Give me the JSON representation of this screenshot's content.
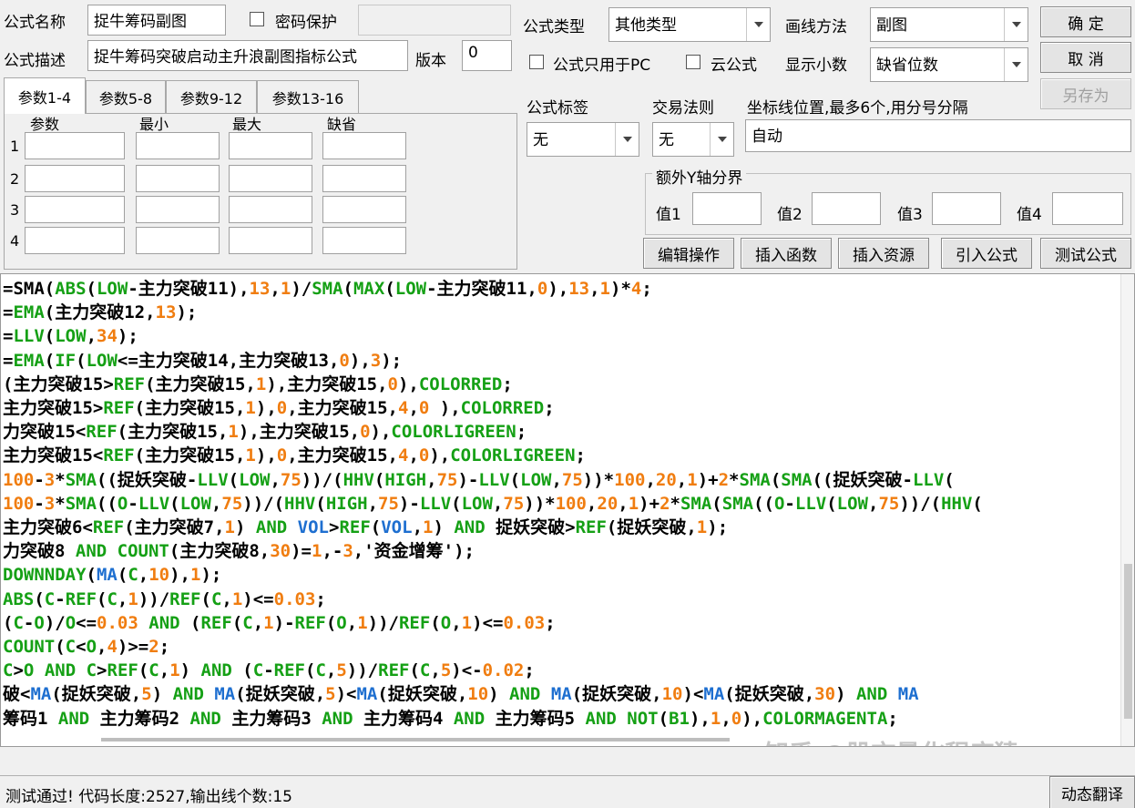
{
  "form": {
    "name_label": "公式名称",
    "name_value": "捉牛筹码副图",
    "password_label": "密码保护",
    "password_value": "",
    "desc_label": "公式描述",
    "desc_value": "捉牛筹码突破启动主升浪副图指标公式",
    "version_label": "版本",
    "version_value": "0",
    "type_label": "公式类型",
    "type_value": "其他类型",
    "draw_label": "画线方法",
    "draw_value": "副图",
    "pc_only_label": "公式只用于PC",
    "cloud_label": "云公式",
    "decimal_label": "显示小数",
    "decimal_value": "缺省位数",
    "tag_label": "公式标签",
    "tag_value": "无",
    "rule_label": "交易法则",
    "rule_value": "无",
    "axis_label": "坐标线位置,最多6个,用分号分隔",
    "axis_value": "自动",
    "extra_y_label": "额外Y轴分界",
    "val_labels": [
      "值1",
      "值2",
      "值3",
      "值4"
    ]
  },
  "buttons": {
    "ok": "确  定",
    "cancel": "取  消",
    "save_as": "另存为",
    "edit_ops": "编辑操作",
    "insert_func": "插入函数",
    "insert_res": "插入资源",
    "import": "引入公式",
    "test": "测试公式",
    "dyn_translate": "动态翻译"
  },
  "params": {
    "tabs": [
      "参数1-4",
      "参数5-8",
      "参数9-12",
      "参数13-16"
    ],
    "headers": [
      "参数",
      "最小",
      "最大",
      "缺省"
    ],
    "rows": [
      "1",
      "2",
      "3",
      "4"
    ]
  },
  "code_lines": [
    [
      [
        "k",
        "=SMA("
      ],
      [
        "g",
        "ABS"
      ],
      [
        "k",
        "("
      ],
      [
        "g",
        "LOW"
      ],
      [
        "k",
        "-主力突破11),"
      ],
      [
        "o",
        "13"
      ],
      [
        "k",
        ","
      ],
      [
        "o",
        "1"
      ],
      [
        "k",
        ")/"
      ],
      [
        "g",
        "SMA"
      ],
      [
        "k",
        "("
      ],
      [
        "g",
        "MAX"
      ],
      [
        "k",
        "("
      ],
      [
        "g",
        "LOW"
      ],
      [
        "k",
        "-主力突破11,"
      ],
      [
        "o",
        "0"
      ],
      [
        "k",
        "),"
      ],
      [
        "o",
        "13"
      ],
      [
        "k",
        ","
      ],
      [
        "o",
        "1"
      ],
      [
        "k",
        ")*"
      ],
      [
        "o",
        "4"
      ],
      [
        "k",
        ";"
      ]
    ],
    [
      [
        "k",
        "="
      ],
      [
        "g",
        "EMA"
      ],
      [
        "k",
        "(主力突破12,"
      ],
      [
        "o",
        "13"
      ],
      [
        "k",
        ");"
      ]
    ],
    [
      [
        "k",
        "="
      ],
      [
        "g",
        "LLV"
      ],
      [
        "k",
        "("
      ],
      [
        "g",
        "LOW"
      ],
      [
        "k",
        ","
      ],
      [
        "o",
        "34"
      ],
      [
        "k",
        ");"
      ]
    ],
    [
      [
        "k",
        "="
      ],
      [
        "g",
        "EMA"
      ],
      [
        "k",
        "("
      ],
      [
        "g",
        "IF"
      ],
      [
        "k",
        "("
      ],
      [
        "g",
        "LOW"
      ],
      [
        "k",
        "<=主力突破14,主力突破13,"
      ],
      [
        "o",
        "0"
      ],
      [
        "k",
        "),"
      ],
      [
        "o",
        "3"
      ],
      [
        "k",
        ");"
      ]
    ],
    [
      [
        "k",
        "(主力突破15>"
      ],
      [
        "g",
        "REF"
      ],
      [
        "k",
        "(主力突破15,"
      ],
      [
        "o",
        "1"
      ],
      [
        "k",
        "),主力突破15,"
      ],
      [
        "o",
        "0"
      ],
      [
        "k",
        "),"
      ],
      [
        "g",
        "COLORRED"
      ],
      [
        "k",
        ";"
      ]
    ],
    [
      [
        "k",
        "主力突破15>"
      ],
      [
        "g",
        "REF"
      ],
      [
        "k",
        "(主力突破15,"
      ],
      [
        "o",
        "1"
      ],
      [
        "k",
        "),"
      ],
      [
        "o",
        "0"
      ],
      [
        "k",
        ",主力突破15,"
      ],
      [
        "o",
        "4"
      ],
      [
        "k",
        ","
      ],
      [
        "o",
        "0"
      ],
      [
        "k",
        " ),"
      ],
      [
        "g",
        "COLORRED"
      ],
      [
        "k",
        ";"
      ]
    ],
    [
      [
        "k",
        "力突破15<"
      ],
      [
        "g",
        "REF"
      ],
      [
        "k",
        "(主力突破15,"
      ],
      [
        "o",
        "1"
      ],
      [
        "k",
        "),主力突破15,"
      ],
      [
        "o",
        "0"
      ],
      [
        "k",
        "),"
      ],
      [
        "g",
        "COLORLIGREEN"
      ],
      [
        "k",
        ";"
      ]
    ],
    [
      [
        "k",
        "主力突破15<"
      ],
      [
        "g",
        "REF"
      ],
      [
        "k",
        "(主力突破15,"
      ],
      [
        "o",
        "1"
      ],
      [
        "k",
        "),"
      ],
      [
        "o",
        "0"
      ],
      [
        "k",
        ",主力突破15,"
      ],
      [
        "o",
        "4"
      ],
      [
        "k",
        ","
      ],
      [
        "o",
        "0"
      ],
      [
        "k",
        "),"
      ],
      [
        "g",
        "COLORLIGREEN"
      ],
      [
        "k",
        ";"
      ]
    ],
    [
      [
        "o",
        "100"
      ],
      [
        "k",
        "-"
      ],
      [
        "o",
        "3"
      ],
      [
        "k",
        "*"
      ],
      [
        "g",
        "SMA"
      ],
      [
        "k",
        "((捉妖突破-"
      ],
      [
        "g",
        "LLV"
      ],
      [
        "k",
        "("
      ],
      [
        "g",
        "LOW"
      ],
      [
        "k",
        ","
      ],
      [
        "o",
        "75"
      ],
      [
        "k",
        "))/("
      ],
      [
        "g",
        "HHV"
      ],
      [
        "k",
        "("
      ],
      [
        "g",
        "HIGH"
      ],
      [
        "k",
        ","
      ],
      [
        "o",
        "75"
      ],
      [
        "k",
        ")-"
      ],
      [
        "g",
        "LLV"
      ],
      [
        "k",
        "("
      ],
      [
        "g",
        "LOW"
      ],
      [
        "k",
        ","
      ],
      [
        "o",
        "75"
      ],
      [
        "k",
        "))*"
      ],
      [
        "o",
        "100"
      ],
      [
        "k",
        ","
      ],
      [
        "o",
        "20"
      ],
      [
        "k",
        ","
      ],
      [
        "o",
        "1"
      ],
      [
        "k",
        ")+"
      ],
      [
        "o",
        "2"
      ],
      [
        "k",
        "*"
      ],
      [
        "g",
        "SMA"
      ],
      [
        "k",
        "("
      ],
      [
        "g",
        "SMA"
      ],
      [
        "k",
        "((捉妖突破-"
      ],
      [
        "g",
        "LLV"
      ],
      [
        "k",
        "("
      ]
    ],
    [
      [
        "o",
        "100"
      ],
      [
        "k",
        "-"
      ],
      [
        "o",
        "3"
      ],
      [
        "k",
        "*"
      ],
      [
        "g",
        "SMA"
      ],
      [
        "k",
        "(("
      ],
      [
        "g",
        "O"
      ],
      [
        "k",
        "-"
      ],
      [
        "g",
        "LLV"
      ],
      [
        "k",
        "("
      ],
      [
        "g",
        "LOW"
      ],
      [
        "k",
        ","
      ],
      [
        "o",
        "75"
      ],
      [
        "k",
        "))/("
      ],
      [
        "g",
        "HHV"
      ],
      [
        "k",
        "("
      ],
      [
        "g",
        "HIGH"
      ],
      [
        "k",
        ","
      ],
      [
        "o",
        "75"
      ],
      [
        "k",
        ")-"
      ],
      [
        "g",
        "LLV"
      ],
      [
        "k",
        "("
      ],
      [
        "g",
        "LOW"
      ],
      [
        "k",
        ","
      ],
      [
        "o",
        "75"
      ],
      [
        "k",
        "))*"
      ],
      [
        "o",
        "100"
      ],
      [
        "k",
        ","
      ],
      [
        "o",
        "20"
      ],
      [
        "k",
        ","
      ],
      [
        "o",
        "1"
      ],
      [
        "k",
        ")+"
      ],
      [
        "o",
        "2"
      ],
      [
        "k",
        "*"
      ],
      [
        "g",
        "SMA"
      ],
      [
        "k",
        "("
      ],
      [
        "g",
        "SMA"
      ],
      [
        "k",
        "(("
      ],
      [
        "g",
        "O"
      ],
      [
        "k",
        "-"
      ],
      [
        "g",
        "LLV"
      ],
      [
        "k",
        "("
      ],
      [
        "g",
        "LOW"
      ],
      [
        "k",
        ","
      ],
      [
        "o",
        "75"
      ],
      [
        "k",
        "))/("
      ],
      [
        "g",
        "HHV"
      ],
      [
        "k",
        "("
      ]
    ],
    [
      [
        "k",
        "主力突破6<"
      ],
      [
        "g",
        "REF"
      ],
      [
        "k",
        "(主力突破7,"
      ],
      [
        "o",
        "1"
      ],
      [
        "k",
        ") "
      ],
      [
        "g",
        "AND"
      ],
      [
        "k",
        " "
      ],
      [
        "b",
        "VOL"
      ],
      [
        "k",
        ">"
      ],
      [
        "g",
        "REF"
      ],
      [
        "k",
        "("
      ],
      [
        "b",
        "VOL"
      ],
      [
        "k",
        ","
      ],
      [
        "o",
        "1"
      ],
      [
        "k",
        ") "
      ],
      [
        "g",
        "AND"
      ],
      [
        "k",
        " 捉妖突破>"
      ],
      [
        "g",
        "REF"
      ],
      [
        "k",
        "(捉妖突破,"
      ],
      [
        "o",
        "1"
      ],
      [
        "k",
        ");"
      ]
    ],
    [
      [
        "k",
        "力突破8 "
      ],
      [
        "g",
        "AND"
      ],
      [
        "k",
        " "
      ],
      [
        "g",
        "COUNT"
      ],
      [
        "k",
        "(主力突破8,"
      ],
      [
        "o",
        "30"
      ],
      [
        "k",
        ")="
      ],
      [
        "o",
        "1"
      ],
      [
        "k",
        ",-"
      ],
      [
        "o",
        "3"
      ],
      [
        "k",
        ",'资金增筹');"
      ]
    ],
    [
      [
        "g",
        "DOWNNDAY"
      ],
      [
        "k",
        "("
      ],
      [
        "b",
        "MA"
      ],
      [
        "k",
        "("
      ],
      [
        "g",
        "C"
      ],
      [
        "k",
        ","
      ],
      [
        "o",
        "10"
      ],
      [
        "k",
        "),"
      ],
      [
        "o",
        "1"
      ],
      [
        "k",
        ");"
      ]
    ],
    [
      [
        "g",
        "ABS"
      ],
      [
        "k",
        "("
      ],
      [
        "g",
        "C"
      ],
      [
        "k",
        "-"
      ],
      [
        "g",
        "REF"
      ],
      [
        "k",
        "("
      ],
      [
        "g",
        "C"
      ],
      [
        "k",
        ","
      ],
      [
        "o",
        "1"
      ],
      [
        "k",
        "))/"
      ],
      [
        "g",
        "REF"
      ],
      [
        "k",
        "("
      ],
      [
        "g",
        "C"
      ],
      [
        "k",
        ","
      ],
      [
        "o",
        "1"
      ],
      [
        "k",
        ")<="
      ],
      [
        "o",
        "0.03"
      ],
      [
        "k",
        ";"
      ]
    ],
    [
      [
        "k",
        "("
      ],
      [
        "g",
        "C"
      ],
      [
        "k",
        "-"
      ],
      [
        "g",
        "O"
      ],
      [
        "k",
        ")/"
      ],
      [
        "g",
        "O"
      ],
      [
        "k",
        "<="
      ],
      [
        "o",
        "0.03"
      ],
      [
        "k",
        " "
      ],
      [
        "g",
        "AND"
      ],
      [
        "k",
        " ("
      ],
      [
        "g",
        "REF"
      ],
      [
        "k",
        "("
      ],
      [
        "g",
        "C"
      ],
      [
        "k",
        ","
      ],
      [
        "o",
        "1"
      ],
      [
        "k",
        ")-"
      ],
      [
        "g",
        "REF"
      ],
      [
        "k",
        "("
      ],
      [
        "g",
        "O"
      ],
      [
        "k",
        ","
      ],
      [
        "o",
        "1"
      ],
      [
        "k",
        "))/"
      ],
      [
        "g",
        "REF"
      ],
      [
        "k",
        "("
      ],
      [
        "g",
        "O"
      ],
      [
        "k",
        ","
      ],
      [
        "o",
        "1"
      ],
      [
        "k",
        ")<="
      ],
      [
        "o",
        "0.03"
      ],
      [
        "k",
        ";"
      ]
    ],
    [
      [
        "g",
        "COUNT"
      ],
      [
        "k",
        "("
      ],
      [
        "g",
        "C"
      ],
      [
        "k",
        "<"
      ],
      [
        "g",
        "O"
      ],
      [
        "k",
        ","
      ],
      [
        "o",
        "4"
      ],
      [
        "k",
        ")>="
      ],
      [
        "o",
        "2"
      ],
      [
        "k",
        ";"
      ]
    ],
    [
      [
        "g",
        "C"
      ],
      [
        "k",
        ">"
      ],
      [
        "g",
        "O"
      ],
      [
        "k",
        " "
      ],
      [
        "g",
        "AND"
      ],
      [
        "k",
        " "
      ],
      [
        "g",
        "C"
      ],
      [
        "k",
        ">"
      ],
      [
        "g",
        "REF"
      ],
      [
        "k",
        "("
      ],
      [
        "g",
        "C"
      ],
      [
        "k",
        ","
      ],
      [
        "o",
        "1"
      ],
      [
        "k",
        ") "
      ],
      [
        "g",
        "AND"
      ],
      [
        "k",
        " ("
      ],
      [
        "g",
        "C"
      ],
      [
        "k",
        "-"
      ],
      [
        "g",
        "REF"
      ],
      [
        "k",
        "("
      ],
      [
        "g",
        "C"
      ],
      [
        "k",
        ","
      ],
      [
        "o",
        "5"
      ],
      [
        "k",
        "))/"
      ],
      [
        "g",
        "REF"
      ],
      [
        "k",
        "("
      ],
      [
        "g",
        "C"
      ],
      [
        "k",
        ","
      ],
      [
        "o",
        "5"
      ],
      [
        "k",
        ")<-"
      ],
      [
        "o",
        "0.02"
      ],
      [
        "k",
        ";"
      ]
    ],
    [
      [
        "k",
        "破<"
      ],
      [
        "b",
        "MA"
      ],
      [
        "k",
        "(捉妖突破,"
      ],
      [
        "o",
        "5"
      ],
      [
        "k",
        ") "
      ],
      [
        "g",
        "AND"
      ],
      [
        "k",
        " "
      ],
      [
        "b",
        "MA"
      ],
      [
        "k",
        "(捉妖突破,"
      ],
      [
        "o",
        "5"
      ],
      [
        "k",
        ")<"
      ],
      [
        "b",
        "MA"
      ],
      [
        "k",
        "(捉妖突破,"
      ],
      [
        "o",
        "10"
      ],
      [
        "k",
        ") "
      ],
      [
        "g",
        "AND"
      ],
      [
        "k",
        " "
      ],
      [
        "b",
        "MA"
      ],
      [
        "k",
        "(捉妖突破,"
      ],
      [
        "o",
        "10"
      ],
      [
        "k",
        ")<"
      ],
      [
        "b",
        "MA"
      ],
      [
        "k",
        "(捉妖突破,"
      ],
      [
        "o",
        "30"
      ],
      [
        "k",
        ") "
      ],
      [
        "g",
        "AND"
      ],
      [
        "k",
        " "
      ],
      [
        "b",
        "MA"
      ]
    ],
    [
      [
        "k",
        "筹码1 "
      ],
      [
        "g",
        "AND"
      ],
      [
        "k",
        " 主力筹码2 "
      ],
      [
        "g",
        "AND"
      ],
      [
        "k",
        " 主力筹码3 "
      ],
      [
        "g",
        "AND"
      ],
      [
        "k",
        " 主力筹码4 "
      ],
      [
        "g",
        "AND"
      ],
      [
        "k",
        " 主力筹码5 "
      ],
      [
        "g",
        "AND"
      ],
      [
        "k",
        " "
      ],
      [
        "g",
        "NOT"
      ],
      [
        "k",
        "("
      ],
      [
        "g",
        "B1"
      ],
      [
        "k",
        "),"
      ],
      [
        "o",
        "1"
      ],
      [
        "k",
        ","
      ],
      [
        "o",
        "0"
      ],
      [
        "k",
        "),"
      ],
      [
        "g",
        "COLORMAGENTA"
      ],
      [
        "k",
        ";"
      ]
    ]
  ],
  "status": {
    "message": "测试通过! 代码长度:2527,输出线个数:15"
  },
  "watermark": "知乎 @股市量化程序猿"
}
